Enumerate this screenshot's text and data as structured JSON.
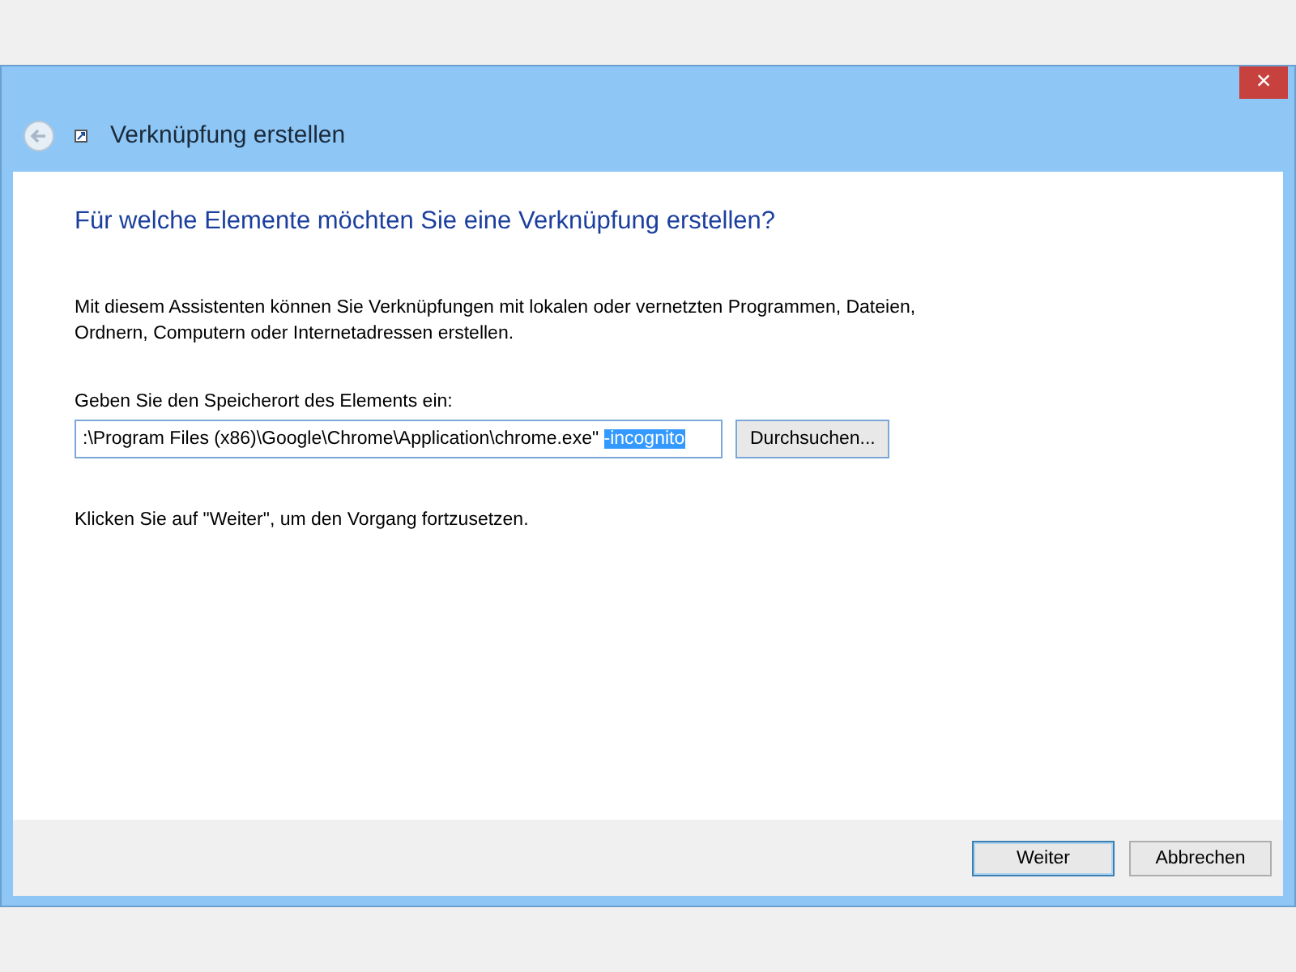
{
  "window": {
    "title": "Verknüpfung erstellen",
    "close_label": "×"
  },
  "heading": "Für welche Elemente möchten Sie eine Verknüpfung erstellen?",
  "description": "Mit diesem Assistenten können Sie Verknüpfungen mit lokalen oder vernetzten Programmen, Dateien, Ordnern, Computern oder Internetadressen erstellen.",
  "location": {
    "label": "Geben Sie den Speicherort des Elements ein:",
    "value": ":\\Program Files (x86)\\Google\\Chrome\\Application\\chrome.exe\" ",
    "selected_text": "-incognito",
    "browse_button": "Durchsuchen..."
  },
  "hint": "Klicken Sie auf \"Weiter\", um den Vorgang fortzusetzen.",
  "buttons": [
    {
      "label": "Weiter",
      "default": true
    },
    {
      "label": "Abbrechen",
      "default": false
    }
  ]
}
